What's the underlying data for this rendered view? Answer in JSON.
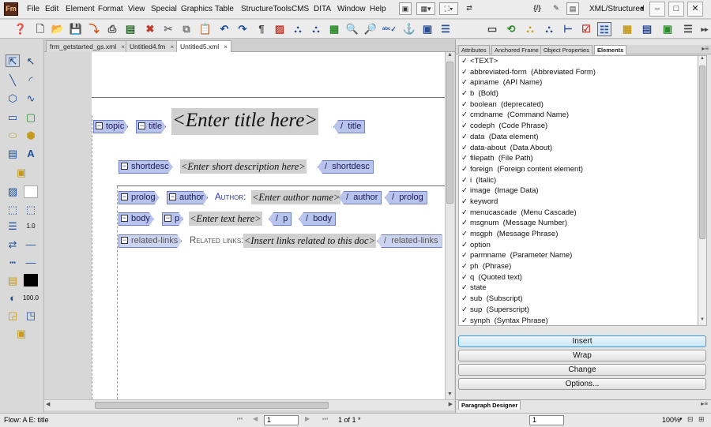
{
  "app": {
    "logo": "Fm"
  },
  "menu": [
    "File",
    "Edit",
    "Element",
    "Format",
    "View",
    "Special",
    "Graphics",
    "Table",
    "StructureTools",
    "CMS",
    "DITA",
    "Window",
    "Help"
  ],
  "workspace": "XML/Structured",
  "tabs": [
    {
      "label": "frm_getstarted_gs.xml",
      "close": "×",
      "active": false
    },
    {
      "label": "Untitled4.fm",
      "close": "×",
      "active": false
    },
    {
      "label": "Untitled5.xml",
      "close": "×",
      "active": true
    }
  ],
  "doc": {
    "topic_tag": "topic",
    "title_tag": "title",
    "title_placeholder": "<Enter title here>",
    "title_end": "title",
    "shortdesc_tag": "shortdesc",
    "shortdesc_placeholder": "<Enter short description here>",
    "shortdesc_end": "shortdesc",
    "prolog_tag": "prolog",
    "author_tag": "author",
    "author_label": "Author:",
    "author_placeholder": "<Enter author name>",
    "author_end": "author",
    "prolog_end": "prolog",
    "body_tag": "body",
    "p_tag": "p",
    "p_placeholder": "<Enter text here>",
    "p_end": "p",
    "body_end": "body",
    "related_tag": "related-links",
    "related_label": "Related links:",
    "related_placeholder": "<Insert links related to this doc>",
    "related_end": "related-links",
    "end_slash": "/"
  },
  "panel": {
    "tabs": [
      "Attributes",
      "Anchored Frame",
      "Object Properties",
      "Elements"
    ],
    "check": "✓",
    "elements": [
      "<TEXT>",
      "abbreviated-form  (Abbreviated Form)",
      "apiname  (API Name)",
      "b  (Bold)",
      "boolean  (deprecated)",
      "cmdname  (Command Name)",
      "codeph  (Code Phrase)",
      "data  (Data element)",
      "data-about  (Data About)",
      "filepath  (File Path)",
      "foreign  (Foreign content element)",
      "i  (Italic)",
      "image  (Image Data)",
      "keyword",
      "menucascade  (Menu Cascade)",
      "msgnum  (Message Number)",
      "msgph  (Message Phrase)",
      "option",
      "parmname  (Parameter Name)",
      "ph  (Phrase)",
      "q  (Quoted text)",
      "state",
      "sub  (Subscript)",
      "sup  (Superscript)",
      "synph  (Syntax Phrase)"
    ],
    "buttons": {
      "insert": "Insert",
      "wrap": "Wrap",
      "change": "Change",
      "options": "Options..."
    },
    "paragraph_designer": "Paragraph Designer"
  },
  "status": {
    "flow": "Flow: A   E: title",
    "page_value": "1",
    "page_of": "1 of 1 *",
    "zoom": "100%",
    "tool_value_1": "1.0",
    "tool_value_2": "100.0"
  },
  "colors": {
    "tag_fill": "#b8c4ec",
    "tag_border": "#6f7fc4",
    "author_label": "#2a35b8"
  }
}
